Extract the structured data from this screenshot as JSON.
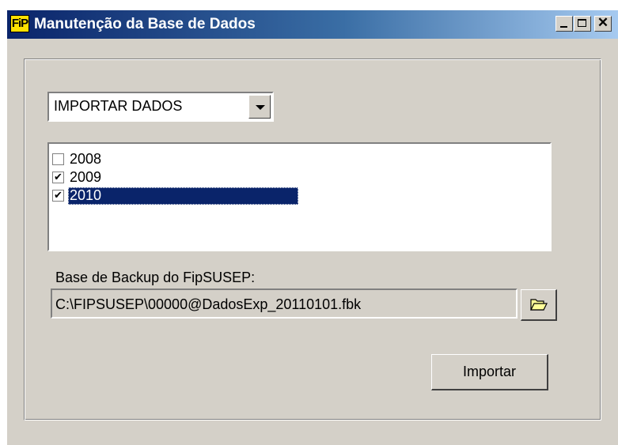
{
  "window": {
    "title": "Manutenção da Base de Dados",
    "app_icon_text": "FiP",
    "close_glyph": "✕"
  },
  "mode_select": {
    "selected": "IMPORTAR DADOS",
    "icon": "chevron-down-icon"
  },
  "years": [
    {
      "label": "2008",
      "checked": false,
      "selected": false,
      "mark": ""
    },
    {
      "label": "2009",
      "checked": true,
      "selected": false,
      "mark": "✔"
    },
    {
      "label": "2010",
      "checked": true,
      "selected": true,
      "mark": "✔"
    }
  ],
  "backup": {
    "label": "Base de Backup do FipSUSEP:",
    "path": "C:\\FIPSUSEP\\00000@DadosExp_20110101.fbk",
    "browse_icon": "folder-open-icon"
  },
  "actions": {
    "import_label": "Importar"
  },
  "colors": {
    "titlebar_start": "#0a246a",
    "titlebar_end": "#a6caf0",
    "face": "#d4d0c8",
    "selection": "#0a246a",
    "folder_icon": "#ffff99"
  }
}
